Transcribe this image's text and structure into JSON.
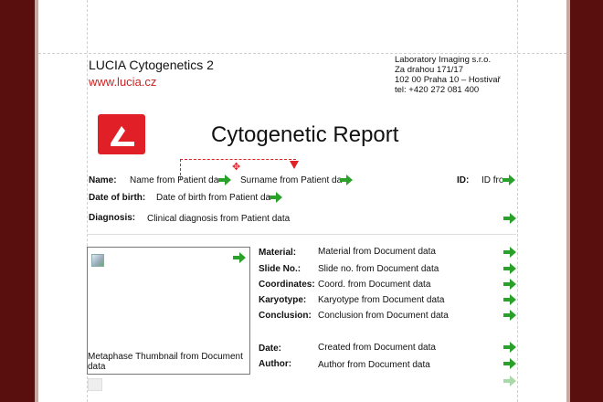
{
  "header": {
    "app_title": "LUCIA Cytogenetics 2",
    "url": "www.lucia.cz",
    "company": [
      "Laboratory Imaging s.r.o.",
      "Za drahou 171/17",
      "102 00 Praha 10 – Hostivař",
      "tel: +420 272 081 400"
    ]
  },
  "report": {
    "title": "Cytogenetic Report"
  },
  "patient": {
    "name_label": "Name:",
    "name_value": "Name from Patient da",
    "surname_value": "Surname from Patient da",
    "id_label": "ID:",
    "id_value": "ID fro",
    "dob_label": "Date of birth:",
    "dob_value": "Date of birth from Patient da",
    "diagnosis_label": "Diagnosis:",
    "diagnosis_value": "Clinical diagnosis from Patient data"
  },
  "thumbnail": {
    "caption": "Metaphase Thumbnail from Document data"
  },
  "document": {
    "material_label": "Material:",
    "material_value": "Material from Document data",
    "slide_label": "Slide No.:",
    "slide_value": "Slide no. from Document data",
    "coords_label": "Coordinates:",
    "coords_value": "Coord. from Document data",
    "karyotype_label": "Karyotype:",
    "karyotype_value": "Karyotype from Document data",
    "conclusion_label": "Conclusion:",
    "conclusion_value": "Conclusion from Document data",
    "date_label": "Date:",
    "date_value": "Created from Document data",
    "author_label": "Author:",
    "author_value": "Author from Document data"
  },
  "colors": {
    "accent_red": "#e11f26",
    "arrow_green": "#2aa12a",
    "frame": "#5a0f0f"
  },
  "icons": {
    "arrow": "green-right-arrow-icon",
    "logo": "lucia-logo-icon",
    "image": "image-placeholder-icon"
  }
}
